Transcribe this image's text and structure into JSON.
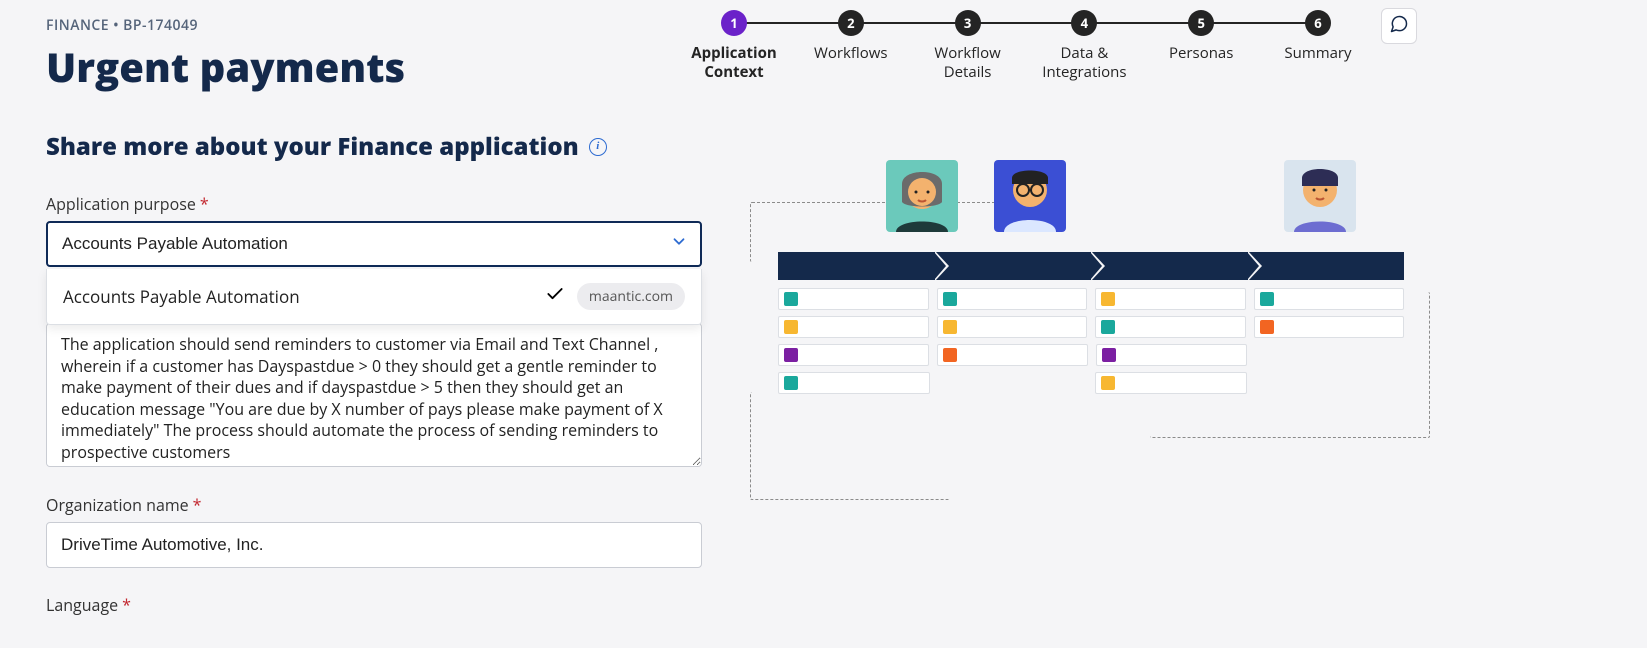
{
  "breadcrumb": {
    "category": "FINANCE",
    "separator": "•",
    "id": "BP-174049"
  },
  "page_title": "Urgent payments",
  "section_heading": "Share more about your Finance application",
  "fields": {
    "purpose": {
      "label": "Application purpose",
      "value": "Accounts Payable Automation",
      "option_label": "Accounts Payable Automation",
      "badge": "maantic.com"
    },
    "description": {
      "value": "The application should send reminders to customer via Email and Text Channel , wherein if a customer has Dayspastdue > 0 they should get a gentle reminder to make payment of their dues and if dayspastdue > 5 then they should get an education message \"You are due by X number of pays please make payment of X immediately\" The process should automate the process of sending reminders to prospective customers"
    },
    "org": {
      "label": "Organization name",
      "value": "DriveTime Automotive, Inc."
    },
    "language": {
      "label": "Language"
    }
  },
  "stepper": [
    {
      "num": "1",
      "label": "Application Context",
      "active": true
    },
    {
      "num": "2",
      "label": "Workflows",
      "active": false
    },
    {
      "num": "3",
      "label": "Workflow Details",
      "active": false
    },
    {
      "num": "4",
      "label": "Data & Integrations",
      "active": false
    },
    {
      "num": "5",
      "label": "Personas",
      "active": false
    },
    {
      "num": "6",
      "label": "Summary",
      "active": false
    }
  ]
}
